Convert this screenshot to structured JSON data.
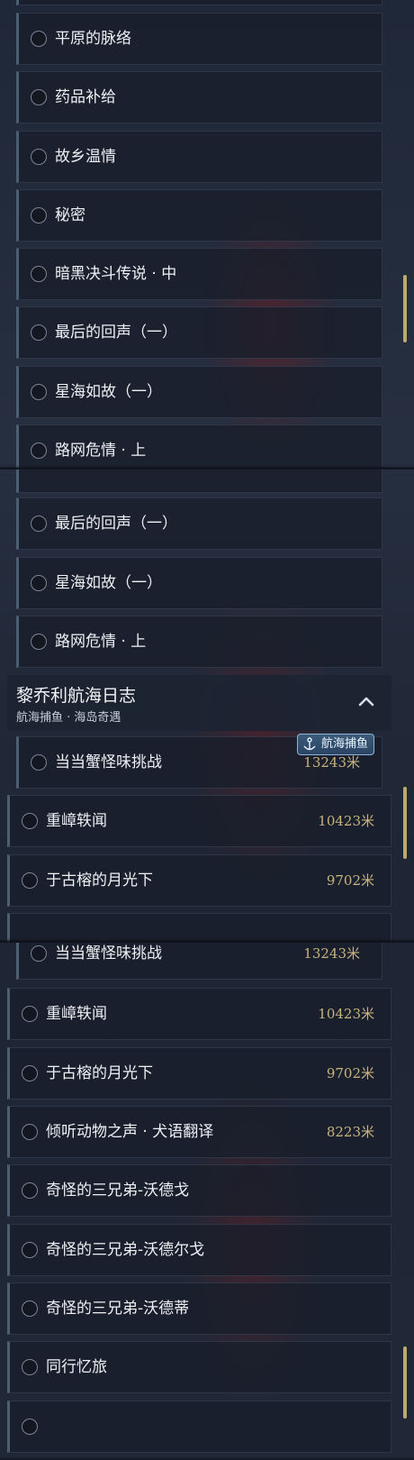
{
  "screen1": {
    "items": [
      "平原的脉络",
      "药品补给",
      "故乡温情",
      "秘密",
      "暗黑决斗传说 · 中",
      "最后的回声（一）",
      "星海如故（一）",
      "路网危情 · 上"
    ]
  },
  "screen2": {
    "items": [
      "最后的回声（一）",
      "星海如故（一）",
      "路网危情 · 上"
    ],
    "section": {
      "title": "黎乔利航海日志",
      "subtitle": "航海捕鱼 · 海岛奇遇",
      "badge": "航海捕鱼",
      "first_item": {
        "label": "当当蟹怪味挑战",
        "distance": "13243米"
      },
      "items": [
        {
          "label": "重嶂轶闻",
          "distance": "10423米"
        },
        {
          "label": "于古榕的月光下",
          "distance": "9702米"
        }
      ]
    }
  },
  "screen3": {
    "first_item": {
      "label": "当当蟹怪味挑战",
      "distance": "13243米"
    },
    "items": [
      {
        "label": "重嶂轶闻",
        "distance": "10423米"
      },
      {
        "label": "于古榕的月光下",
        "distance": "9702米"
      },
      {
        "label": "倾听动物之声 · 犬语翻译",
        "distance": "8223米"
      },
      {
        "label": "奇怪的三兄弟-沃德戈",
        "distance": ""
      },
      {
        "label": "奇怪的三兄弟-沃德尔戈",
        "distance": ""
      },
      {
        "label": "奇怪的三兄弟-沃德蒂",
        "distance": ""
      },
      {
        "label": "同行忆旅",
        "distance": ""
      }
    ]
  },
  "colors": {
    "accent_gold": "#c9b37f",
    "scrollbar": "#bda86e",
    "badge_blue": "#3b5c7a"
  }
}
